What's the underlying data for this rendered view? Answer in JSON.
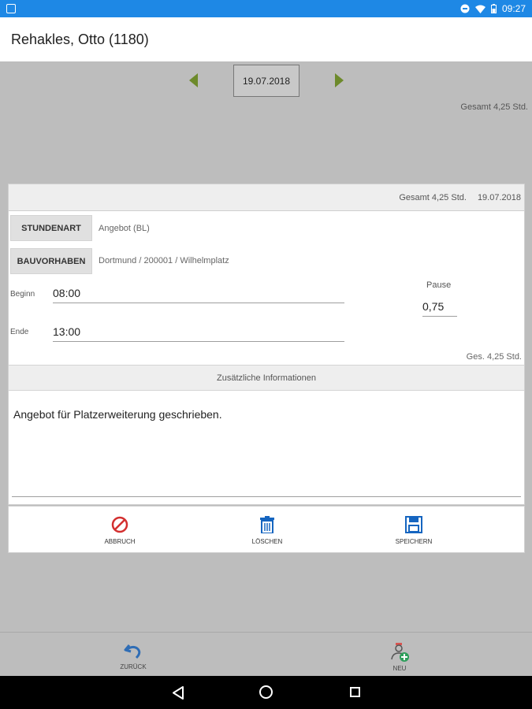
{
  "status_bar": {
    "time": "09:27"
  },
  "app_bar": {
    "title": "Rehakles, Otto (1180)"
  },
  "date_nav": {
    "date": "19.07.2018"
  },
  "summary_top": "Gesamt 4,25 Std.",
  "card": {
    "header_total": "Gesamt 4,25 Std.",
    "header_date": "19.07.2018",
    "stundenart": {
      "label": "STUNDENART",
      "value": "Angebot (BL)"
    },
    "bauvorhaben": {
      "label": "BAUVORHABEN",
      "value": "Dortmund / 200001 / Wilhelmplatz"
    },
    "beginn": {
      "label": "Beginn",
      "value": "08:00"
    },
    "ende": {
      "label": "Ende",
      "value": "13:00"
    },
    "pause": {
      "label": "Pause",
      "value": "0,75"
    },
    "ges_total": "Ges. 4,25 Std.",
    "info_header": "Zusätzliche Informationen",
    "info_text": "Angebot für Platzerweiterung geschrieben."
  },
  "actions": {
    "cancel": "ABBRUCH",
    "delete": "LÖSCHEN",
    "save": "SPEICHERN"
  },
  "bottom_bar": {
    "back": "ZURÜCK",
    "new": "NEU"
  },
  "colors": {
    "status_bar": "#1e88e5",
    "arrow": "#6d8a2b",
    "cancel_icon": "#d32f2f",
    "action_icon": "#1565c0",
    "new_icon": "#2e9e5b"
  },
  "icons": {
    "cancel": "cancel-icon",
    "delete": "trash-icon",
    "save": "floppy-icon",
    "back": "undo-icon",
    "new": "add-person-icon"
  }
}
